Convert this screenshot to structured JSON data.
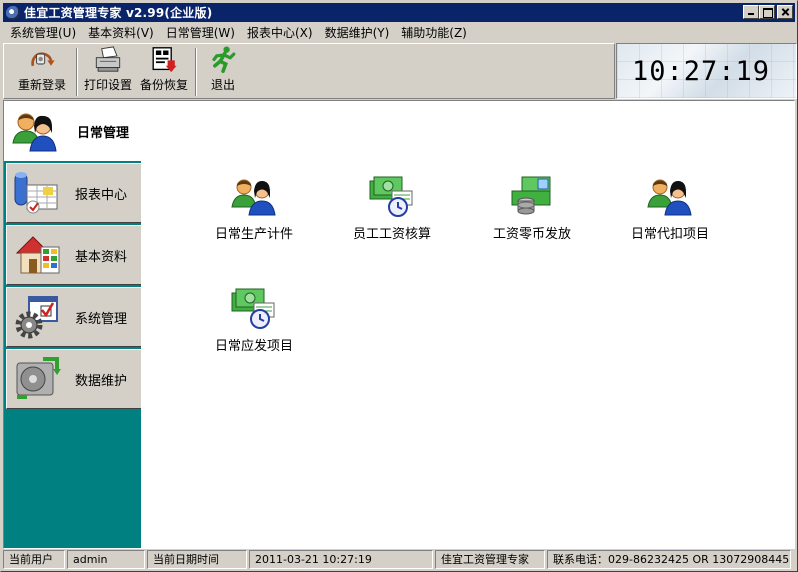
{
  "window": {
    "title": "佳宜工资管理专家 v2.99(企业版)"
  },
  "menu": [
    {
      "label": "系统管理(U)"
    },
    {
      "label": "基本资料(V)"
    },
    {
      "label": "日常管理(W)"
    },
    {
      "label": "报表中心(X)"
    },
    {
      "label": "数据维护(Y)"
    },
    {
      "label": "辅助功能(Z)"
    }
  ],
  "toolbar": {
    "relogin": "重新登录",
    "print_settings": "打印设置",
    "backup_restore": "备份恢复",
    "exit": "退出"
  },
  "clock": {
    "time": "10:27:19"
  },
  "sidebar": {
    "items": [
      {
        "label": "日常管理",
        "icon": "people-icon",
        "active": true
      },
      {
        "label": "报表中心",
        "icon": "report-icon",
        "active": false
      },
      {
        "label": "基本资料",
        "icon": "house-icon",
        "active": false
      },
      {
        "label": "系统管理",
        "icon": "settings-icon",
        "active": false
      },
      {
        "label": "数据维护",
        "icon": "disk-icon",
        "active": false
      }
    ]
  },
  "main": {
    "items": [
      {
        "label": "日常生产计件",
        "icon": "people-icon"
      },
      {
        "label": "员工工资核算",
        "icon": "money-clock-icon"
      },
      {
        "label": "工资零币发放",
        "icon": "coins-icon"
      },
      {
        "label": "日常代扣项目",
        "icon": "people-icon"
      },
      {
        "label": "日常应发项目",
        "icon": "money-clock-icon"
      }
    ]
  },
  "status": {
    "user_label": "当前用户",
    "user_value": "admin",
    "datetime_label": "当前日期时间",
    "datetime_value": "2011-03-21 10:27:19",
    "app_name": "佳宜工资管理专家",
    "contact": "联系电话：029-86232425  OR  13072908445"
  }
}
